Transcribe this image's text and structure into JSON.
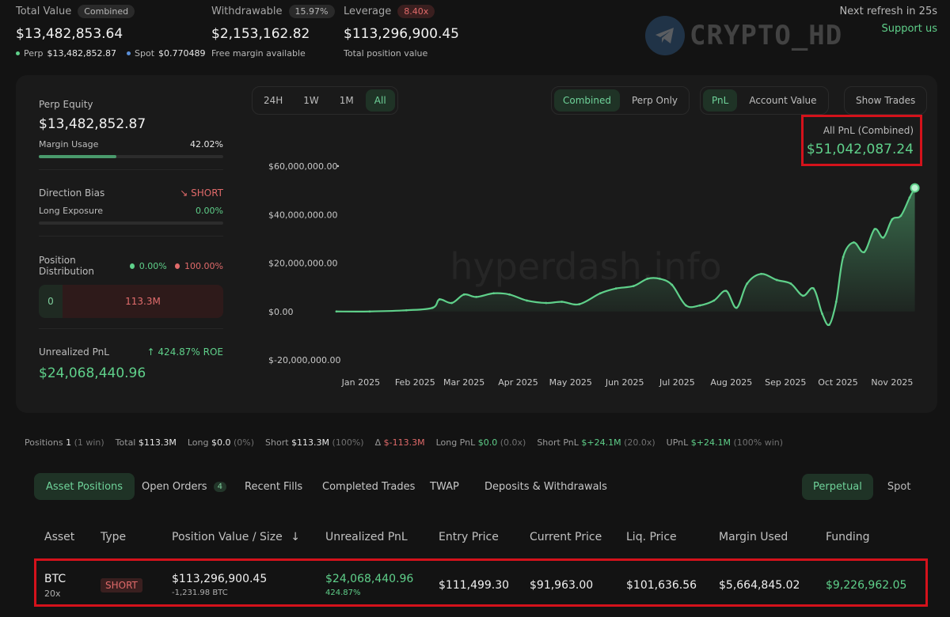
{
  "header": {
    "total_value": {
      "label": "Total Value",
      "badge": "Combined",
      "value": "$13,482,853.64",
      "perp_label": "Perp",
      "perp_value": "$13,482,852.87",
      "spot_label": "Spot",
      "spot_value": "$0.770489"
    },
    "withdrawable": {
      "label": "Withdrawable",
      "badge": "15.97%",
      "value": "$2,153,162.82",
      "sub": "Free margin available"
    },
    "leverage": {
      "label": "Leverage",
      "badge": "8.40x",
      "value": "$113,296,900.45",
      "sub": "Total position value"
    },
    "refresh": "Next refresh in 25s",
    "support": "Support us",
    "watermark": "CRYPTO_HD"
  },
  "left_panel": {
    "perp_equity_label": "Perp Equity",
    "perp_equity_value": "$13,482,852.87",
    "margin_usage_label": "Margin Usage",
    "margin_usage_value": "42.02%",
    "margin_usage_fraction": 0.4202,
    "direction_bias_label": "Direction Bias",
    "direction_bias_value": "SHORT",
    "long_exposure_label": "Long Exposure",
    "long_exposure_value": "0.00%",
    "position_distribution_label": "Position Distribution",
    "dist_long_pct": "0.00%",
    "dist_short_pct": "100.00%",
    "dist_long_value": "0",
    "dist_short_value": "113.3M",
    "unrealized_pnl_label": "Unrealized PnL",
    "roe": "424.87% ROE",
    "unrealized_pnl_value": "$24,068,440.96"
  },
  "chart_controls": {
    "ranges": [
      "24H",
      "1W",
      "1M",
      "All"
    ],
    "active_range": "All",
    "modes": [
      "Combined",
      "Perp Only"
    ],
    "active_mode": "Combined",
    "metrics": [
      "PnL",
      "Account Value"
    ],
    "active_metric": "PnL",
    "show_trades": "Show Trades"
  },
  "pnl_box": {
    "title": "All PnL (Combined)",
    "value": "$51,042,087.24"
  },
  "chart_data": {
    "type": "area",
    "title": "",
    "watermark": "hyperdash.info",
    "y_ticks": [
      "$60,000,000.00",
      "$40,000,000.00",
      "$20,000,000.00",
      "$0.00",
      "$-20,000,000.00"
    ],
    "x_ticks": [
      "Jan 2025",
      "Feb 2025",
      "Mar 2025",
      "Apr 2025",
      "May 2025",
      "Jun 2025",
      "Jul 2025",
      "Aug 2025",
      "Sep 2025",
      "Oct 2025",
      "Nov 2025"
    ],
    "ylim": [
      -20000000,
      60000000
    ],
    "color": "#5fd08a",
    "series": [
      {
        "x": [
          "2025-01-01",
          "2025-01-20",
          "2025-02-10",
          "2025-02-25",
          "2025-03-01",
          "2025-03-08",
          "2025-03-15",
          "2025-03-22",
          "2025-04-01",
          "2025-04-10",
          "2025-04-20",
          "2025-05-01",
          "2025-05-10",
          "2025-05-20",
          "2025-06-01",
          "2025-06-10",
          "2025-06-20",
          "2025-06-28",
          "2025-07-05",
          "2025-07-12",
          "2025-07-20",
          "2025-07-28",
          "2025-08-05",
          "2025-08-12",
          "2025-08-18",
          "2025-08-24",
          "2025-09-01",
          "2025-09-10",
          "2025-09-18",
          "2025-09-25",
          "2025-10-01",
          "2025-10-06",
          "2025-10-10",
          "2025-10-14",
          "2025-10-18",
          "2025-10-24",
          "2025-10-30",
          "2025-11-05",
          "2025-11-10",
          "2025-11-15",
          "2025-11-20",
          "2025-11-25",
          "2025-11-28"
        ],
        "values": [
          0,
          0,
          500000,
          1500000,
          5000000,
          3500000,
          7000000,
          6000000,
          7500000,
          7000000,
          4500000,
          3500000,
          4000000,
          3000000,
          7500000,
          9500000,
          10500000,
          13500000,
          13500000,
          11000000,
          2500000,
          2500000,
          4500000,
          8500000,
          1500000,
          11500000,
          15500000,
          13000000,
          11500000,
          6500000,
          9500000,
          -1000000,
          -5500000,
          4000000,
          22500000,
          28500000,
          24500000,
          34000000,
          30500000,
          38000000,
          39500000,
          47000000,
          51000000
        ]
      }
    ]
  },
  "summary": {
    "positions_label": "Positions",
    "positions_value": "1",
    "positions_win": "(1 win)",
    "total_label": "Total",
    "total_value": "$113.3M",
    "long_label": "Long",
    "long_value": "$0.0",
    "long_pct": "(0%)",
    "short_label": "Short",
    "short_value": "$113.3M",
    "short_pct": "(100%)",
    "delta_label": "Δ",
    "delta_value": "$-113.3M",
    "long_pnl_label": "Long PnL",
    "long_pnl_value": "$0.0",
    "long_pnl_x": "(0.0x)",
    "short_pnl_label": "Short PnL",
    "short_pnl_value": "$+24.1M",
    "short_pnl_x": "(20.0x)",
    "upnl_label": "UPnL",
    "upnl_value": "$+24.1M",
    "upnl_win": "(100% win)"
  },
  "tabs": {
    "asset_positions": "Asset Positions",
    "open_orders": "Open Orders",
    "open_orders_count": "4",
    "recent_fills": "Recent Fills",
    "completed_trades": "Completed Trades",
    "twap": "TWAP",
    "deposits": "Deposits & Withdrawals",
    "perpetual": "Perpetual",
    "spot": "Spot"
  },
  "table": {
    "headers": {
      "asset": "Asset",
      "type": "Type",
      "position_value": "Position Value / Size",
      "sort_arrow": "↓",
      "upnl": "Unrealized PnL",
      "entry": "Entry Price",
      "current": "Current Price",
      "liq": "Liq. Price",
      "margin": "Margin Used",
      "funding": "Funding"
    },
    "row": {
      "asset": "BTC",
      "leverage": "20x",
      "type": "SHORT",
      "position_value": "$113,296,900.45",
      "size": "-1,231.98 BTC",
      "upnl": "$24,068,440.96",
      "upnl_pct": "424.87%",
      "entry": "$111,499.30",
      "current": "$91,963.00",
      "liq": "$101,636.56",
      "margin": "$5,664,845.02",
      "funding": "$9,226,962.05"
    }
  }
}
